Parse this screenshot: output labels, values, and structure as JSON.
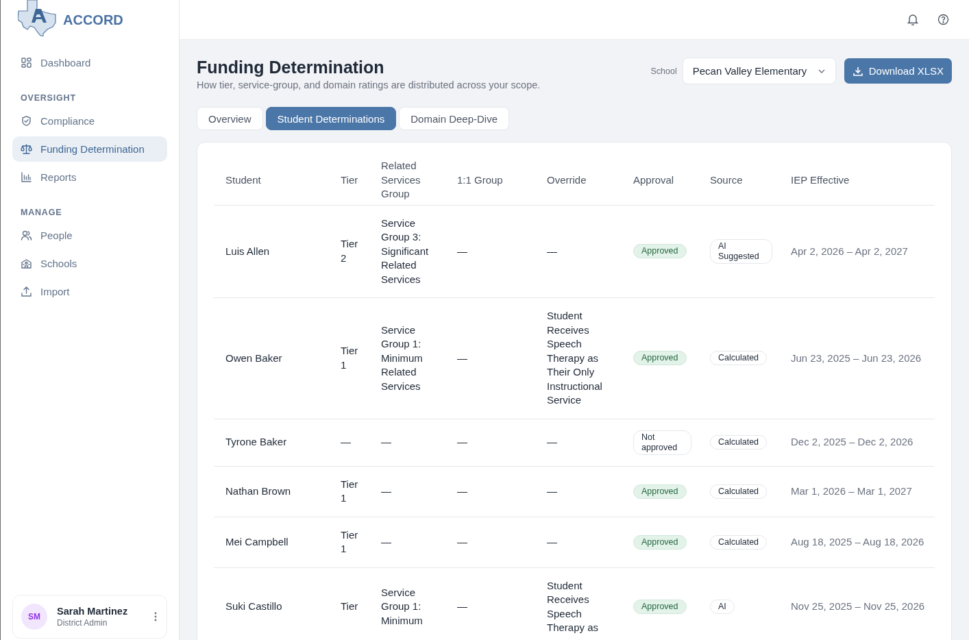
{
  "brand": {
    "name": "ACCORD"
  },
  "sidebar": {
    "items": [
      {
        "kind": "item",
        "label": "Dashboard",
        "selected": false
      },
      {
        "kind": "section",
        "label": "OVERSIGHT"
      },
      {
        "kind": "item",
        "label": "Compliance",
        "selected": false
      },
      {
        "kind": "item",
        "label": "Funding Determination",
        "selected": true
      },
      {
        "kind": "item",
        "label": "Reports",
        "selected": false
      },
      {
        "kind": "section",
        "label": "MANAGE"
      },
      {
        "kind": "item",
        "label": "People",
        "selected": false
      },
      {
        "kind": "item",
        "label": "Schools",
        "selected": false
      },
      {
        "kind": "item",
        "label": "Import",
        "selected": false
      }
    ],
    "user": {
      "initials": "SM",
      "name": "Sarah Martinez",
      "role": "District Admin"
    }
  },
  "page": {
    "title": "Funding Determination",
    "subtitle": "How tier, service-group, and domain ratings are distributed across your scope.",
    "school_label": "School",
    "school": "Pecan Valley Elementary",
    "download": "Download XLSX"
  },
  "tabs": [
    {
      "label": "Overview",
      "selected": false
    },
    {
      "label": "Student Determinations",
      "selected": true
    },
    {
      "label": "Domain Deep-Dive",
      "selected": false
    }
  ],
  "table": {
    "columns": [
      "Student",
      "Tier",
      "Related Services Group",
      "1:1 Group",
      "Override",
      "Approval",
      "Source",
      "IEP Effective"
    ],
    "rows": [
      {
        "student": "Luis Allen",
        "tier": "Tier 2",
        "group": "Service Group 3: Significant Related Services",
        "one_to_one": "—",
        "override": "—",
        "approval": {
          "label": "Approved",
          "kind": "approved"
        },
        "source": "AI Suggested",
        "iep": "Apr 2, 2026 – Apr 2, 2027"
      },
      {
        "student": "Owen Baker",
        "tier": "Tier 1",
        "group": "Service Group 1: Minimum Related Services",
        "one_to_one": "—",
        "override": "Student Receives Speech Therapy as Their Only Instructional Service",
        "approval": {
          "label": "Approved",
          "kind": "approved"
        },
        "source": "Calculated",
        "iep": "Jun 23, 2025 – Jun 23, 2026"
      },
      {
        "student": "Tyrone Baker",
        "tier": "—",
        "group": "—",
        "one_to_one": "—",
        "override": "—",
        "approval": {
          "label": "Not approved",
          "kind": "pending"
        },
        "source": "Calculated",
        "iep": "Dec 2, 2025 – Dec 2, 2026"
      },
      {
        "student": "Nathan Brown",
        "tier": "Tier 1",
        "group": "—",
        "one_to_one": "—",
        "override": "—",
        "approval": {
          "label": "Approved",
          "kind": "approved"
        },
        "source": "Calculated",
        "iep": "Mar 1, 2026 – Mar 1, 2027"
      },
      {
        "student": "Mei Campbell",
        "tier": "Tier 1",
        "group": "—",
        "one_to_one": "—",
        "override": "—",
        "approval": {
          "label": "Approved",
          "kind": "approved"
        },
        "source": "Calculated",
        "iep": "Aug 18, 2025 – Aug 18, 2026"
      },
      {
        "student": "Suki Castillo",
        "tier": "Tier",
        "group": "Service Group 1: Minimum",
        "one_to_one": "—",
        "override": "Student Receives Speech Therapy as",
        "approval": {
          "label": "Approved",
          "kind": "approved"
        },
        "source": "AI",
        "iep": "Nov 25, 2025 – Nov 25, 2026"
      }
    ]
  }
}
